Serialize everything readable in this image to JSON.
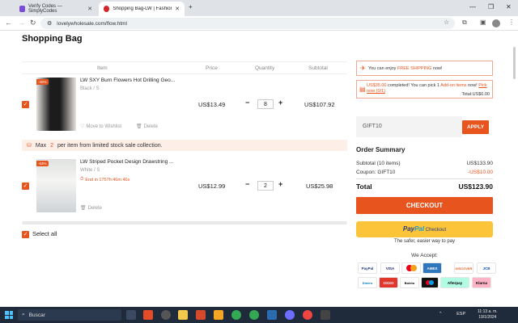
{
  "browser": {
    "tabs": [
      {
        "title": "Verify Codes — SimplyCodes",
        "active": false
      },
      {
        "title": "Shopping Bag-LW | Fashion Onl",
        "active": true
      }
    ],
    "url": "lovelywholesale.com/flow.html"
  },
  "page": {
    "title": "Shopping Bag",
    "table_headers": {
      "item": "Item",
      "price": "Price",
      "quantity": "Quantity",
      "subtotal": "Subtotal"
    },
    "items": [
      {
        "name": "LW SXY Burn Flowers Hot Drilling Geo...",
        "variant": "Black / S",
        "badge": "-40%",
        "price": "US$13.49",
        "quantity": "8",
        "subtotal": "US$107.92",
        "actions": {
          "wishlist": "Move to Wishlist",
          "delete": "Delete"
        }
      },
      {
        "name": "LW Striped Pocket Design Drawstring ...",
        "variant": "White / S",
        "badge": "-63%",
        "timer": "End in 1757h:46m:46s",
        "price": "US$12.99",
        "quantity": "2",
        "subtotal": "US$25.98",
        "actions": {
          "delete": "Delete"
        }
      }
    ],
    "notice": {
      "prefix": "Max",
      "num": "2",
      "suffix": "per item from limited stock sale collection."
    },
    "select_all": "Select all"
  },
  "sidebar": {
    "free_shipping": {
      "prefix": "You can enjoy",
      "highlight": "FREE SHIPPING",
      "suffix": "now!"
    },
    "addon": {
      "amount": "US$35.00",
      "text1": "completed! You can pick",
      "count": "1",
      "link1": "Add-on items",
      "text2": "now!",
      "link2": "Pick now (0/1)",
      "total": "Total:US$0.00"
    },
    "coupon_code": "GIFT10",
    "apply": "APPLY",
    "order_summary": {
      "title": "Order Summary",
      "subtotal_label": "Subtotal (10 items)",
      "subtotal_value": "US$133.90",
      "coupon_label": "Coupon: GIFT10",
      "coupon_value": "-US$10.00",
      "total_label": "Total",
      "total_value": "US$123.90"
    },
    "checkout": "CHECKOUT",
    "paypal": {
      "p1": "Pay",
      "p2": "Pal",
      "label": "Checkout",
      "tagline": "The safer, easier way to pay"
    },
    "we_accept": "We Accept:",
    "payment_methods": [
      "PayPal",
      "VISA",
      "MC",
      "AMEX",
      "DISCOVER",
      "JCB",
      "Diners",
      "OXXO",
      "Boleto",
      "Afterpay",
      "Klarna",
      "Maestro"
    ]
  },
  "taskbar": {
    "search": "Buscar",
    "lang": "ESP",
    "time": "11:13 a. m.",
    "date": "19/1/2024"
  }
}
